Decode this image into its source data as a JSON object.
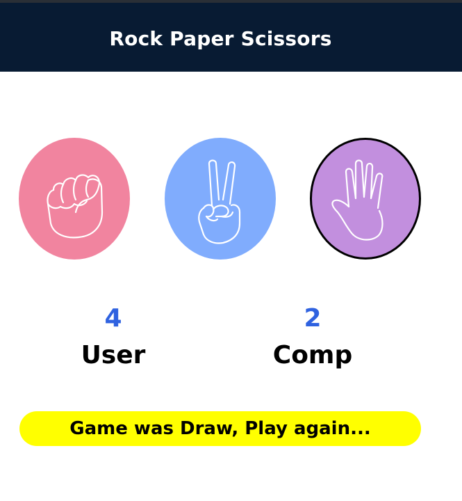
{
  "header": {
    "title": "Rock Paper Scissors"
  },
  "choices": [
    {
      "id": "rock",
      "icon": "rock-fist-icon",
      "color": "#f1849f"
    },
    {
      "id": "scissors",
      "icon": "scissors-peace-icon",
      "color": "#80acfd"
    },
    {
      "id": "paper",
      "icon": "paper-hand-icon",
      "color": "#c28fde",
      "selected": true
    }
  ],
  "scoreboard": {
    "user": {
      "score": "4",
      "label": "User"
    },
    "comp": {
      "score": "2",
      "label": "Comp"
    }
  },
  "message": {
    "text": "Game was Draw, Play again...",
    "background": "#ffff00"
  },
  "colors": {
    "header": "#081b33",
    "score": "#2f62e0"
  }
}
